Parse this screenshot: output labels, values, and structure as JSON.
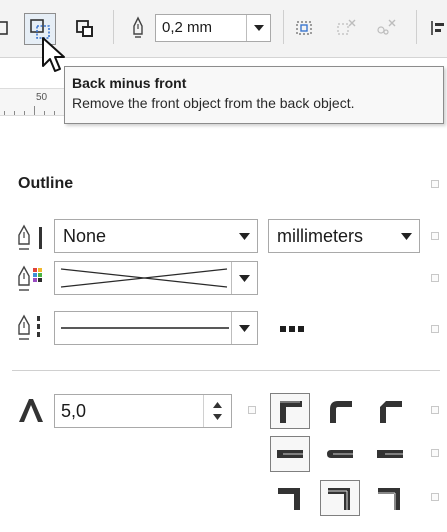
{
  "toolbar": {
    "outline_width_value": "0,2 mm",
    "icons": [
      "intersect-icon",
      "back-minus-front-icon",
      "front-minus-back-icon",
      "pen-outline-icon",
      "create-boundary-icon",
      "weld-disabled-icon",
      "trim-disabled-icon",
      "align-icon"
    ]
  },
  "ruler": {
    "tick_label": "50"
  },
  "tooltip": {
    "title": "Back minus front",
    "description": "Remove the front object from the back object."
  },
  "panel": {
    "title": "Outline",
    "width_value": "None",
    "units_value": "millimeters",
    "miter_limit_value": "5,0"
  },
  "colors": {
    "toolbar_bg": "#f3f3f3",
    "tooltip_bg": "#f8f8f8",
    "text": "#1a1a1a",
    "selected_border": "#7f7f7f"
  }
}
